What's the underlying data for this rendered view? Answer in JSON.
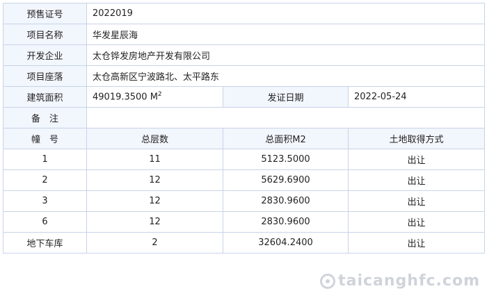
{
  "info": {
    "presale_label": "预售证号",
    "presale_value": "2022019",
    "project_name_label": "项目名称",
    "project_name_value": "华发星辰海",
    "developer_label": "开发企业",
    "developer_value": "太仓铧发房地产开发有限公司",
    "location_label": "项目座落",
    "location_value": "太仓高新区宁波路北、太平路东",
    "area_label": "建筑面积",
    "area_value": "49019.3500 M",
    "area_unit_sup": "2",
    "issue_date_label": "发证日期",
    "issue_date_value": "2022-05-24",
    "remark_label": "备　注",
    "remark_value": ""
  },
  "buildings": {
    "headers": [
      "幢　号",
      "总层数",
      "总面积M2",
      "土地取得方式"
    ],
    "rows": [
      [
        "1",
        "11",
        "5123.5000",
        "出让"
      ],
      [
        "2",
        "12",
        "5629.6900",
        "出让"
      ],
      [
        "3",
        "12",
        "2830.9600",
        "出让"
      ],
      [
        "6",
        "12",
        "2830.9600",
        "出让"
      ],
      [
        "地下车库",
        "2",
        "32604.2400",
        "出让"
      ]
    ]
  },
  "watermark": "taicanghfc.com"
}
